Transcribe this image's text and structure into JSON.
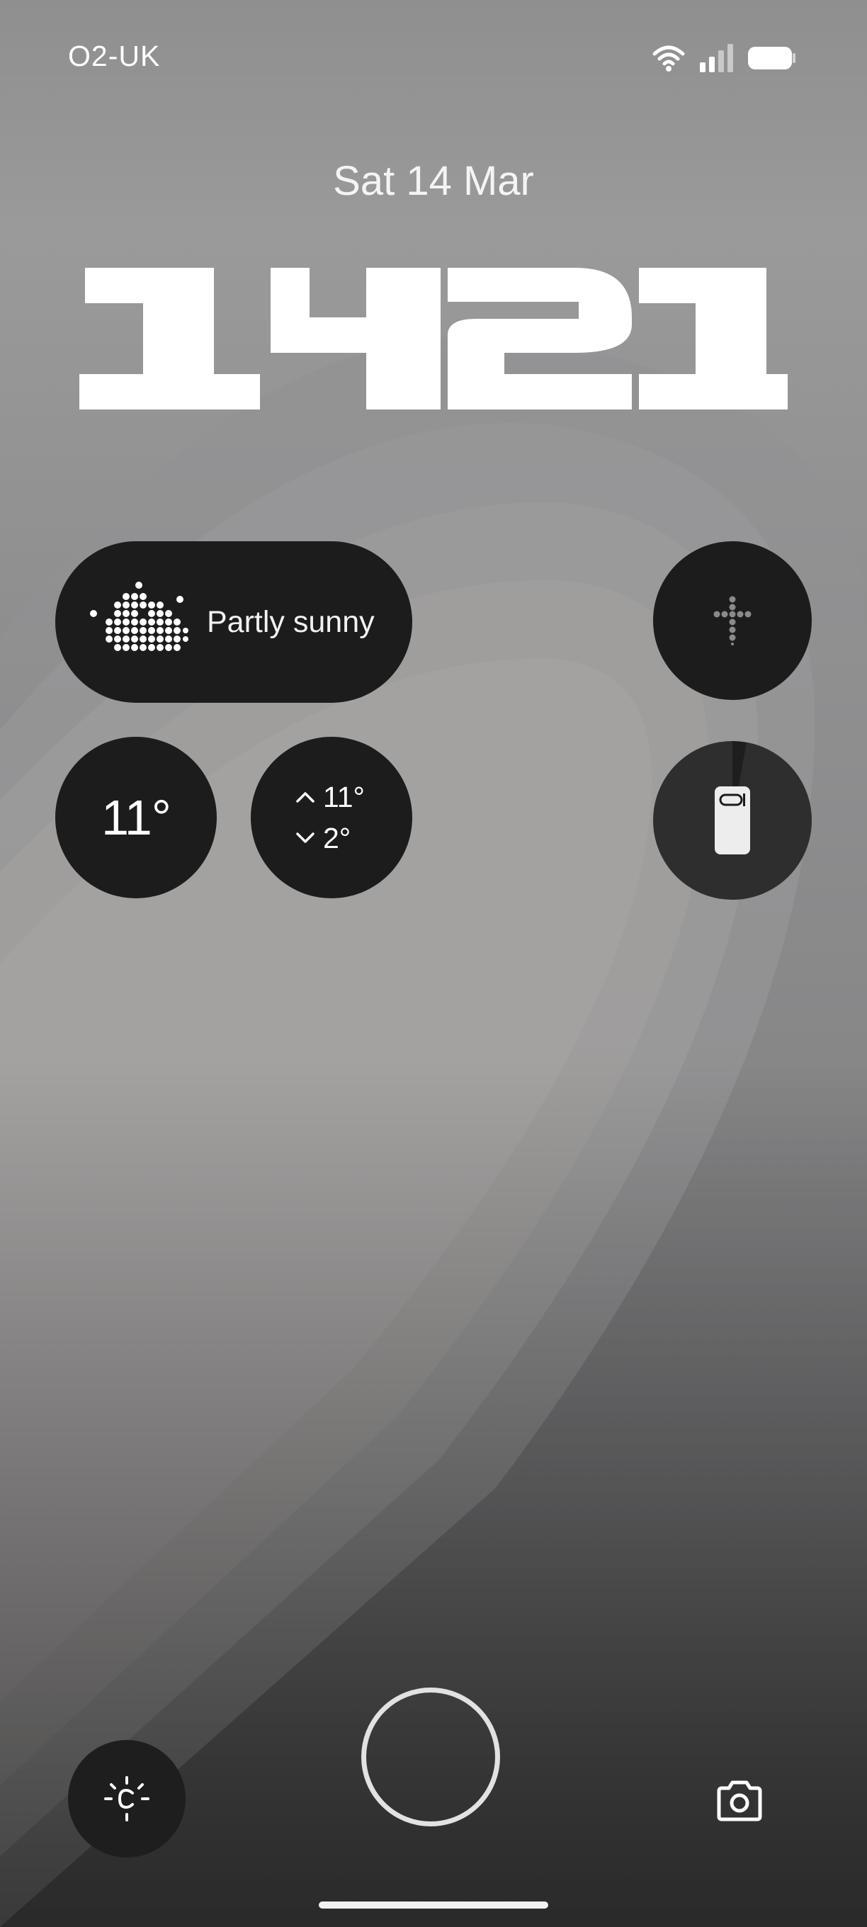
{
  "status_bar": {
    "carrier": "O2-UK",
    "icons": [
      "wifi-icon",
      "signal-icon",
      "battery-icon"
    ]
  },
  "lock_screen": {
    "date": "Sat 14 Mar",
    "time": "1421"
  },
  "weather": {
    "icon": "partly-sunny-icon",
    "condition": "Partly sunny",
    "current_temp": "11°",
    "high": "11°",
    "low": "2°"
  },
  "widgets": {
    "compass_icon": "compass-icon",
    "device_icon": "phone-battery-icon",
    "device_battery_fraction": 0.96
  },
  "shortcuts": {
    "left": "torch-icon",
    "center": "fingerprint-sensor",
    "right": "camera-icon"
  },
  "colors": {
    "widget_bg": "#1c1c1c",
    "text": "#ffffff"
  }
}
